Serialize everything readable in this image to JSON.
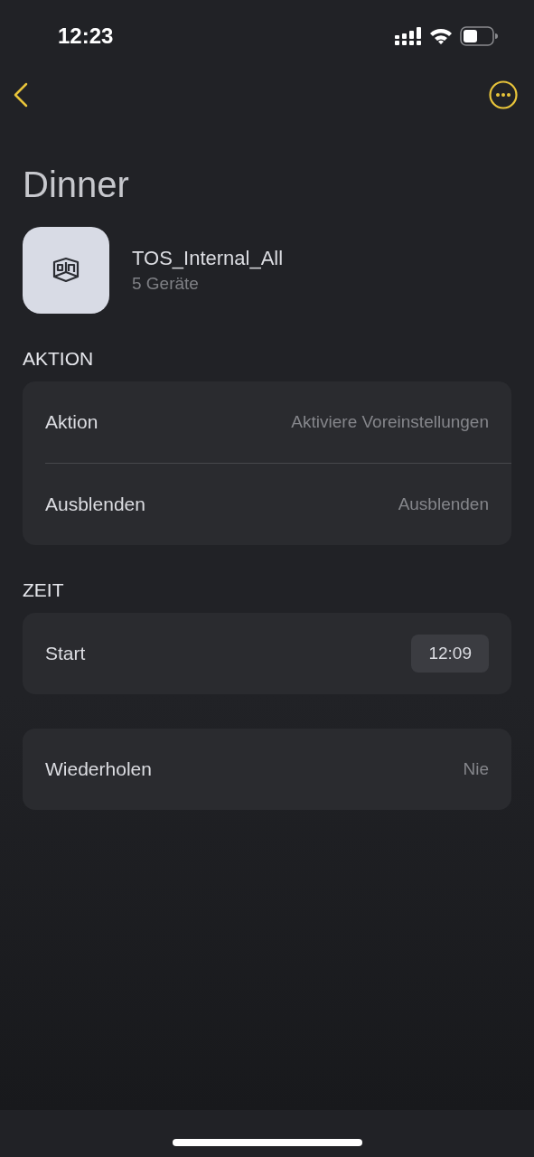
{
  "status_bar": {
    "time": "12:23"
  },
  "title": "Dinner",
  "group": {
    "name": "TOS_Internal_All",
    "subtitle": "5 Geräte"
  },
  "sections": [
    {
      "header": "AKTION",
      "rows": [
        {
          "kind": "value",
          "label": "Aktion",
          "value": "Aktiviere Voreinstellungen"
        },
        {
          "kind": "value",
          "label": "Ausblenden",
          "value": "Ausblenden"
        }
      ]
    },
    {
      "header": "ZEIT",
      "rows": [
        {
          "kind": "time",
          "label": "Start",
          "value": "12:09"
        }
      ]
    },
    {
      "rows": [
        {
          "kind": "value",
          "label": "Wiederholen",
          "value": "Nie"
        }
      ]
    }
  ]
}
